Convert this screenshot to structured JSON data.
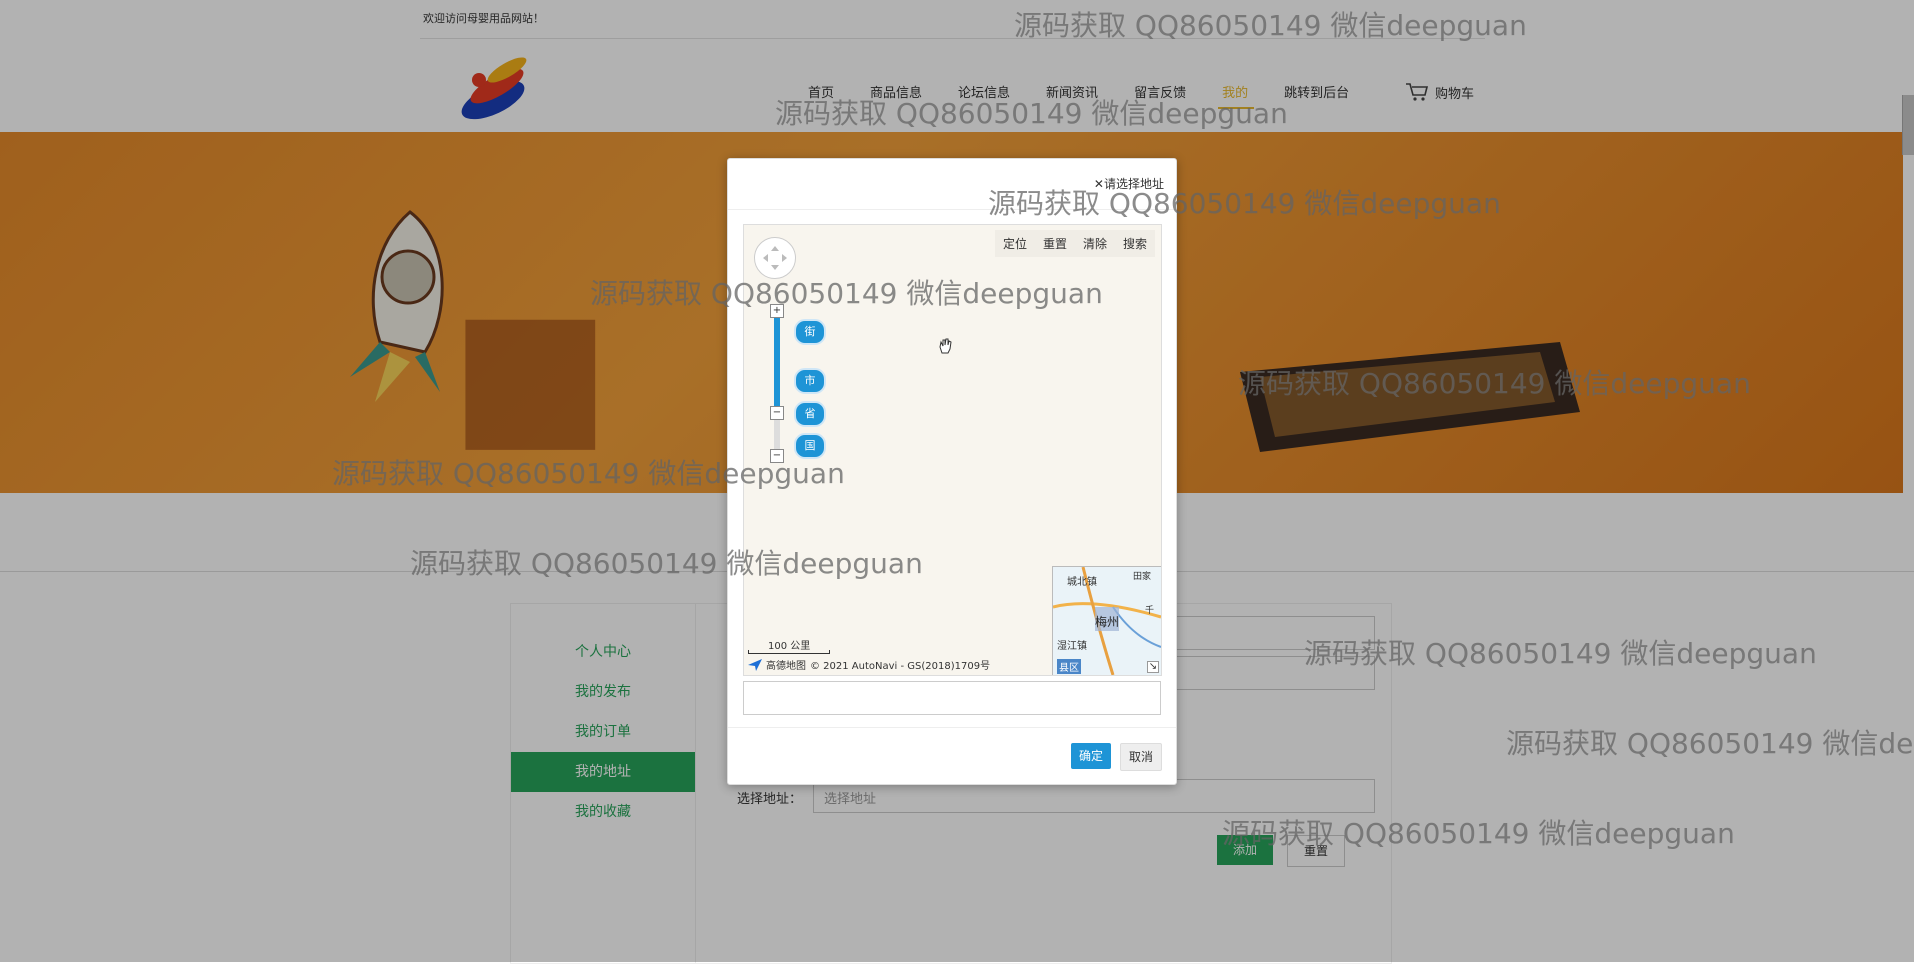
{
  "header": {
    "welcome": "欢迎访问母婴用品网站！",
    "nav": [
      "首页",
      "商品信息",
      "论坛信息",
      "新闻资讯",
      "留言反馈",
      "我的",
      "跳转到后台"
    ],
    "active_nav_index": 5,
    "cart": "购物车"
  },
  "colors": {
    "accent_green": "#28a45b",
    "nav_active": "#e8b92f",
    "primary_blue": "#1e94d6"
  },
  "sidebar": {
    "items": [
      "个人中心",
      "我的发布",
      "我的订单",
      "我的地址",
      "我的收藏"
    ],
    "active_index": 3
  },
  "form": {
    "address_label": "选择地址：",
    "address_placeholder": "选择地址",
    "add_button": "添加",
    "reset_button": "重置"
  },
  "modal": {
    "title": "请选择地址",
    "map_toolbar": [
      "定位",
      "重置",
      "清除",
      "搜索"
    ],
    "levels": [
      "街",
      "市",
      "省",
      "国"
    ],
    "scale": "100 公里",
    "map_brand": "高德地图",
    "copyright": "© 2021 AutoNavi - GS(2018)1709号",
    "minimap_labels": [
      "城北镇",
      "梅州",
      "田家",
      "湿江镇",
      "县区",
      "千"
    ],
    "confirm": "确定",
    "cancel": "取消"
  },
  "watermark": "源码获取 QQ86050149 微信deepguan"
}
